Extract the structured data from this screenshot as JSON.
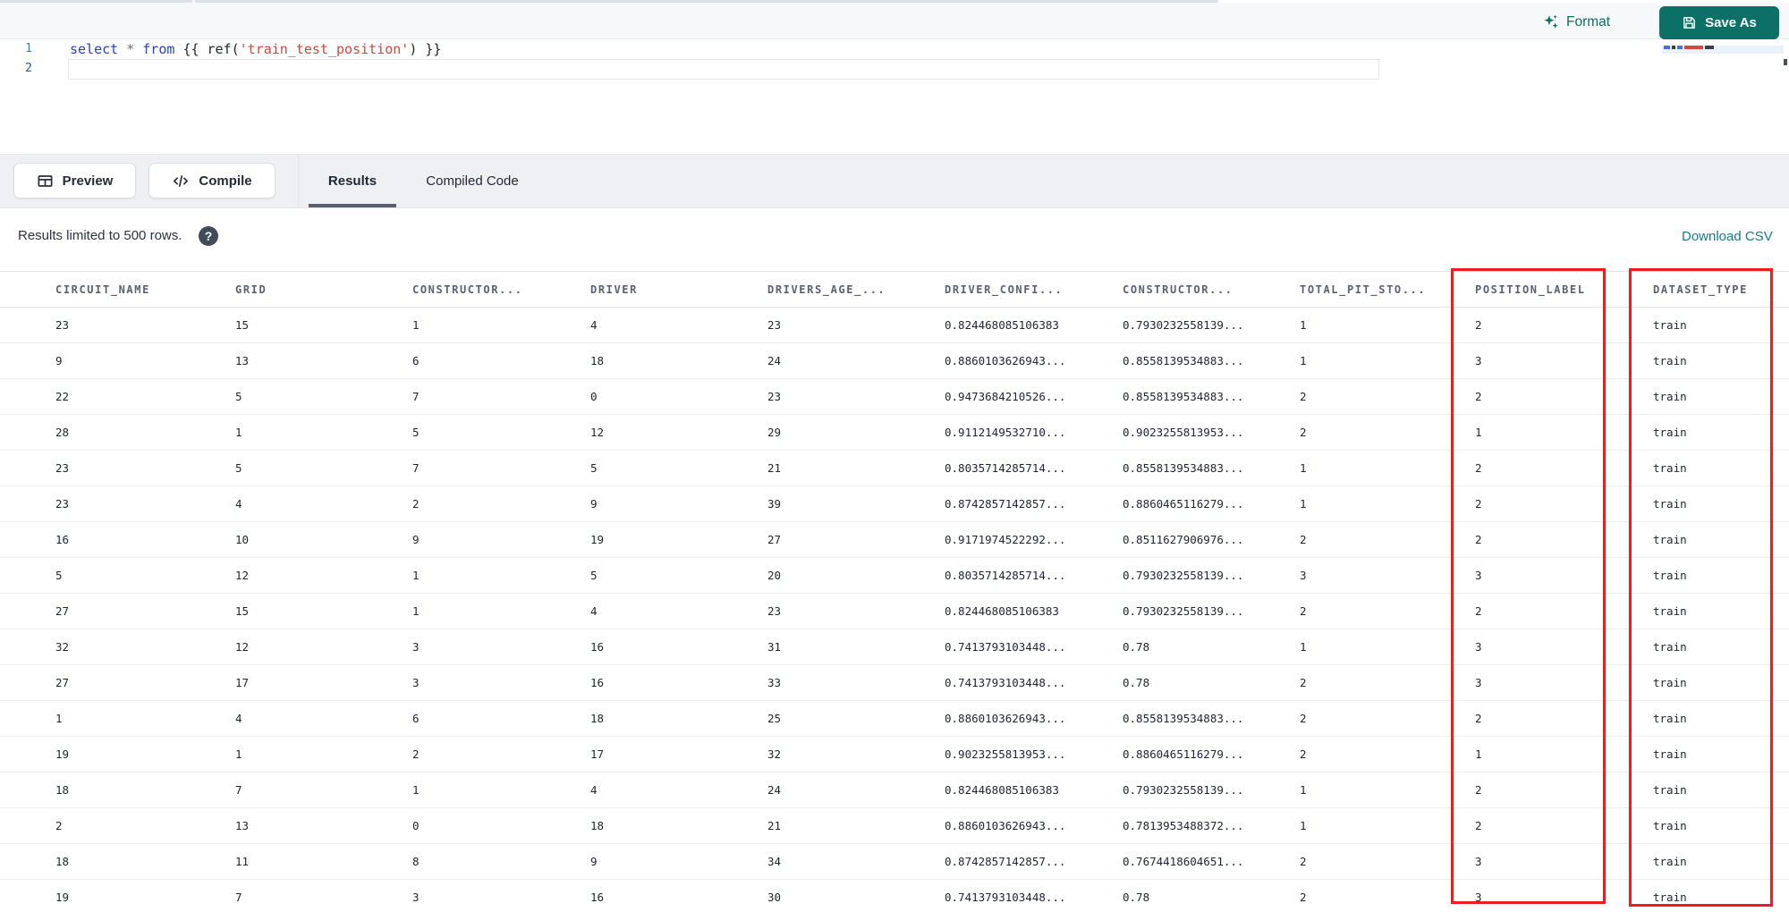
{
  "toolbar": {
    "format_label": "Format",
    "save_as_label": "Save As"
  },
  "editor": {
    "content": "select * from {{ ref('train_test_position') }}",
    "lines": [
      {
        "number": "1"
      },
      {
        "number": "2"
      }
    ],
    "tokens": [
      {
        "text": "select ",
        "type": "keyword"
      },
      {
        "text": "* ",
        "type": "operator"
      },
      {
        "text": "from ",
        "type": "keyword"
      },
      {
        "text": "{{ ",
        "type": "bracket"
      },
      {
        "text": "ref(",
        "type": "function"
      },
      {
        "text": "'train_test_position'",
        "type": "string"
      },
      {
        "text": ") }}",
        "type": "bracket"
      }
    ]
  },
  "actions": {
    "preview_label": "Preview",
    "compile_label": "Compile"
  },
  "tabs": [
    {
      "label": "Results",
      "active": true
    },
    {
      "label": "Compiled Code",
      "active": false
    }
  ],
  "results": {
    "limit_notice": "Results limited to 500 rows.",
    "help_icon": "?",
    "download_label": "Download CSV"
  },
  "table": {
    "columns": [
      "CIRCUIT_NAME",
      "GRID",
      "CONSTRUCTOR...",
      "DRIVER",
      "DRIVERS_AGE_...",
      "DRIVER_CONFI...",
      "CONSTRUCTOR...",
      "TOTAL_PIT_STO...",
      "POSITION_LABEL",
      "DATASET_TYPE"
    ],
    "rows": [
      [
        "23",
        "15",
        "1",
        "4",
        "23",
        "0.824468085106383",
        "0.7930232558139...",
        "1",
        "2",
        "train"
      ],
      [
        "9",
        "13",
        "6",
        "18",
        "24",
        "0.8860103626943...",
        "0.8558139534883...",
        "1",
        "3",
        "train"
      ],
      [
        "22",
        "5",
        "7",
        "0",
        "23",
        "0.9473684210526...",
        "0.8558139534883...",
        "2",
        "2",
        "train"
      ],
      [
        "28",
        "1",
        "5",
        "12",
        "29",
        "0.9112149532710...",
        "0.9023255813953...",
        "2",
        "1",
        "train"
      ],
      [
        "23",
        "5",
        "7",
        "5",
        "21",
        "0.8035714285714...",
        "0.8558139534883...",
        "1",
        "2",
        "train"
      ],
      [
        "23",
        "4",
        "2",
        "9",
        "39",
        "0.8742857142857...",
        "0.8860465116279...",
        "1",
        "2",
        "train"
      ],
      [
        "16",
        "10",
        "9",
        "19",
        "27",
        "0.9171974522292...",
        "0.8511627906976...",
        "2",
        "2",
        "train"
      ],
      [
        "5",
        "12",
        "1",
        "5",
        "20",
        "0.8035714285714...",
        "0.7930232558139...",
        "3",
        "3",
        "train"
      ],
      [
        "27",
        "15",
        "1",
        "4",
        "23",
        "0.824468085106383",
        "0.7930232558139...",
        "2",
        "2",
        "train"
      ],
      [
        "32",
        "12",
        "3",
        "16",
        "31",
        "0.7413793103448...",
        "0.78",
        "1",
        "3",
        "train"
      ],
      [
        "27",
        "17",
        "3",
        "16",
        "33",
        "0.7413793103448...",
        "0.78",
        "2",
        "3",
        "train"
      ],
      [
        "1",
        "4",
        "6",
        "18",
        "25",
        "0.8860103626943...",
        "0.8558139534883...",
        "2",
        "2",
        "train"
      ],
      [
        "19",
        "1",
        "2",
        "17",
        "32",
        "0.9023255813953...",
        "0.8860465116279...",
        "2",
        "1",
        "train"
      ],
      [
        "18",
        "7",
        "1",
        "4",
        "24",
        "0.824468085106383",
        "0.7930232558139...",
        "1",
        "2",
        "train"
      ],
      [
        "2",
        "13",
        "0",
        "18",
        "21",
        "0.8860103626943...",
        "0.7813953488372...",
        "1",
        "2",
        "train"
      ],
      [
        "18",
        "11",
        "8",
        "9",
        "34",
        "0.8742857142857...",
        "0.7674418604651...",
        "2",
        "3",
        "train"
      ],
      [
        "19",
        "7",
        "3",
        "16",
        "30",
        "0.7413793103448...",
        "0.78",
        "2",
        "3",
        "train"
      ]
    ]
  },
  "annotations": {
    "highlighted_columns": [
      "POSITION_LABEL",
      "DATASET_TYPE"
    ],
    "box_color": "#ee1c1c"
  },
  "colors": {
    "accent_teal": "#0b7166",
    "link_teal": "#15798c",
    "keyword_blue": "#2443c4",
    "string_red": "#d4463e",
    "tab_underline": "#57606e",
    "highlight_red": "#ee1c1c"
  }
}
